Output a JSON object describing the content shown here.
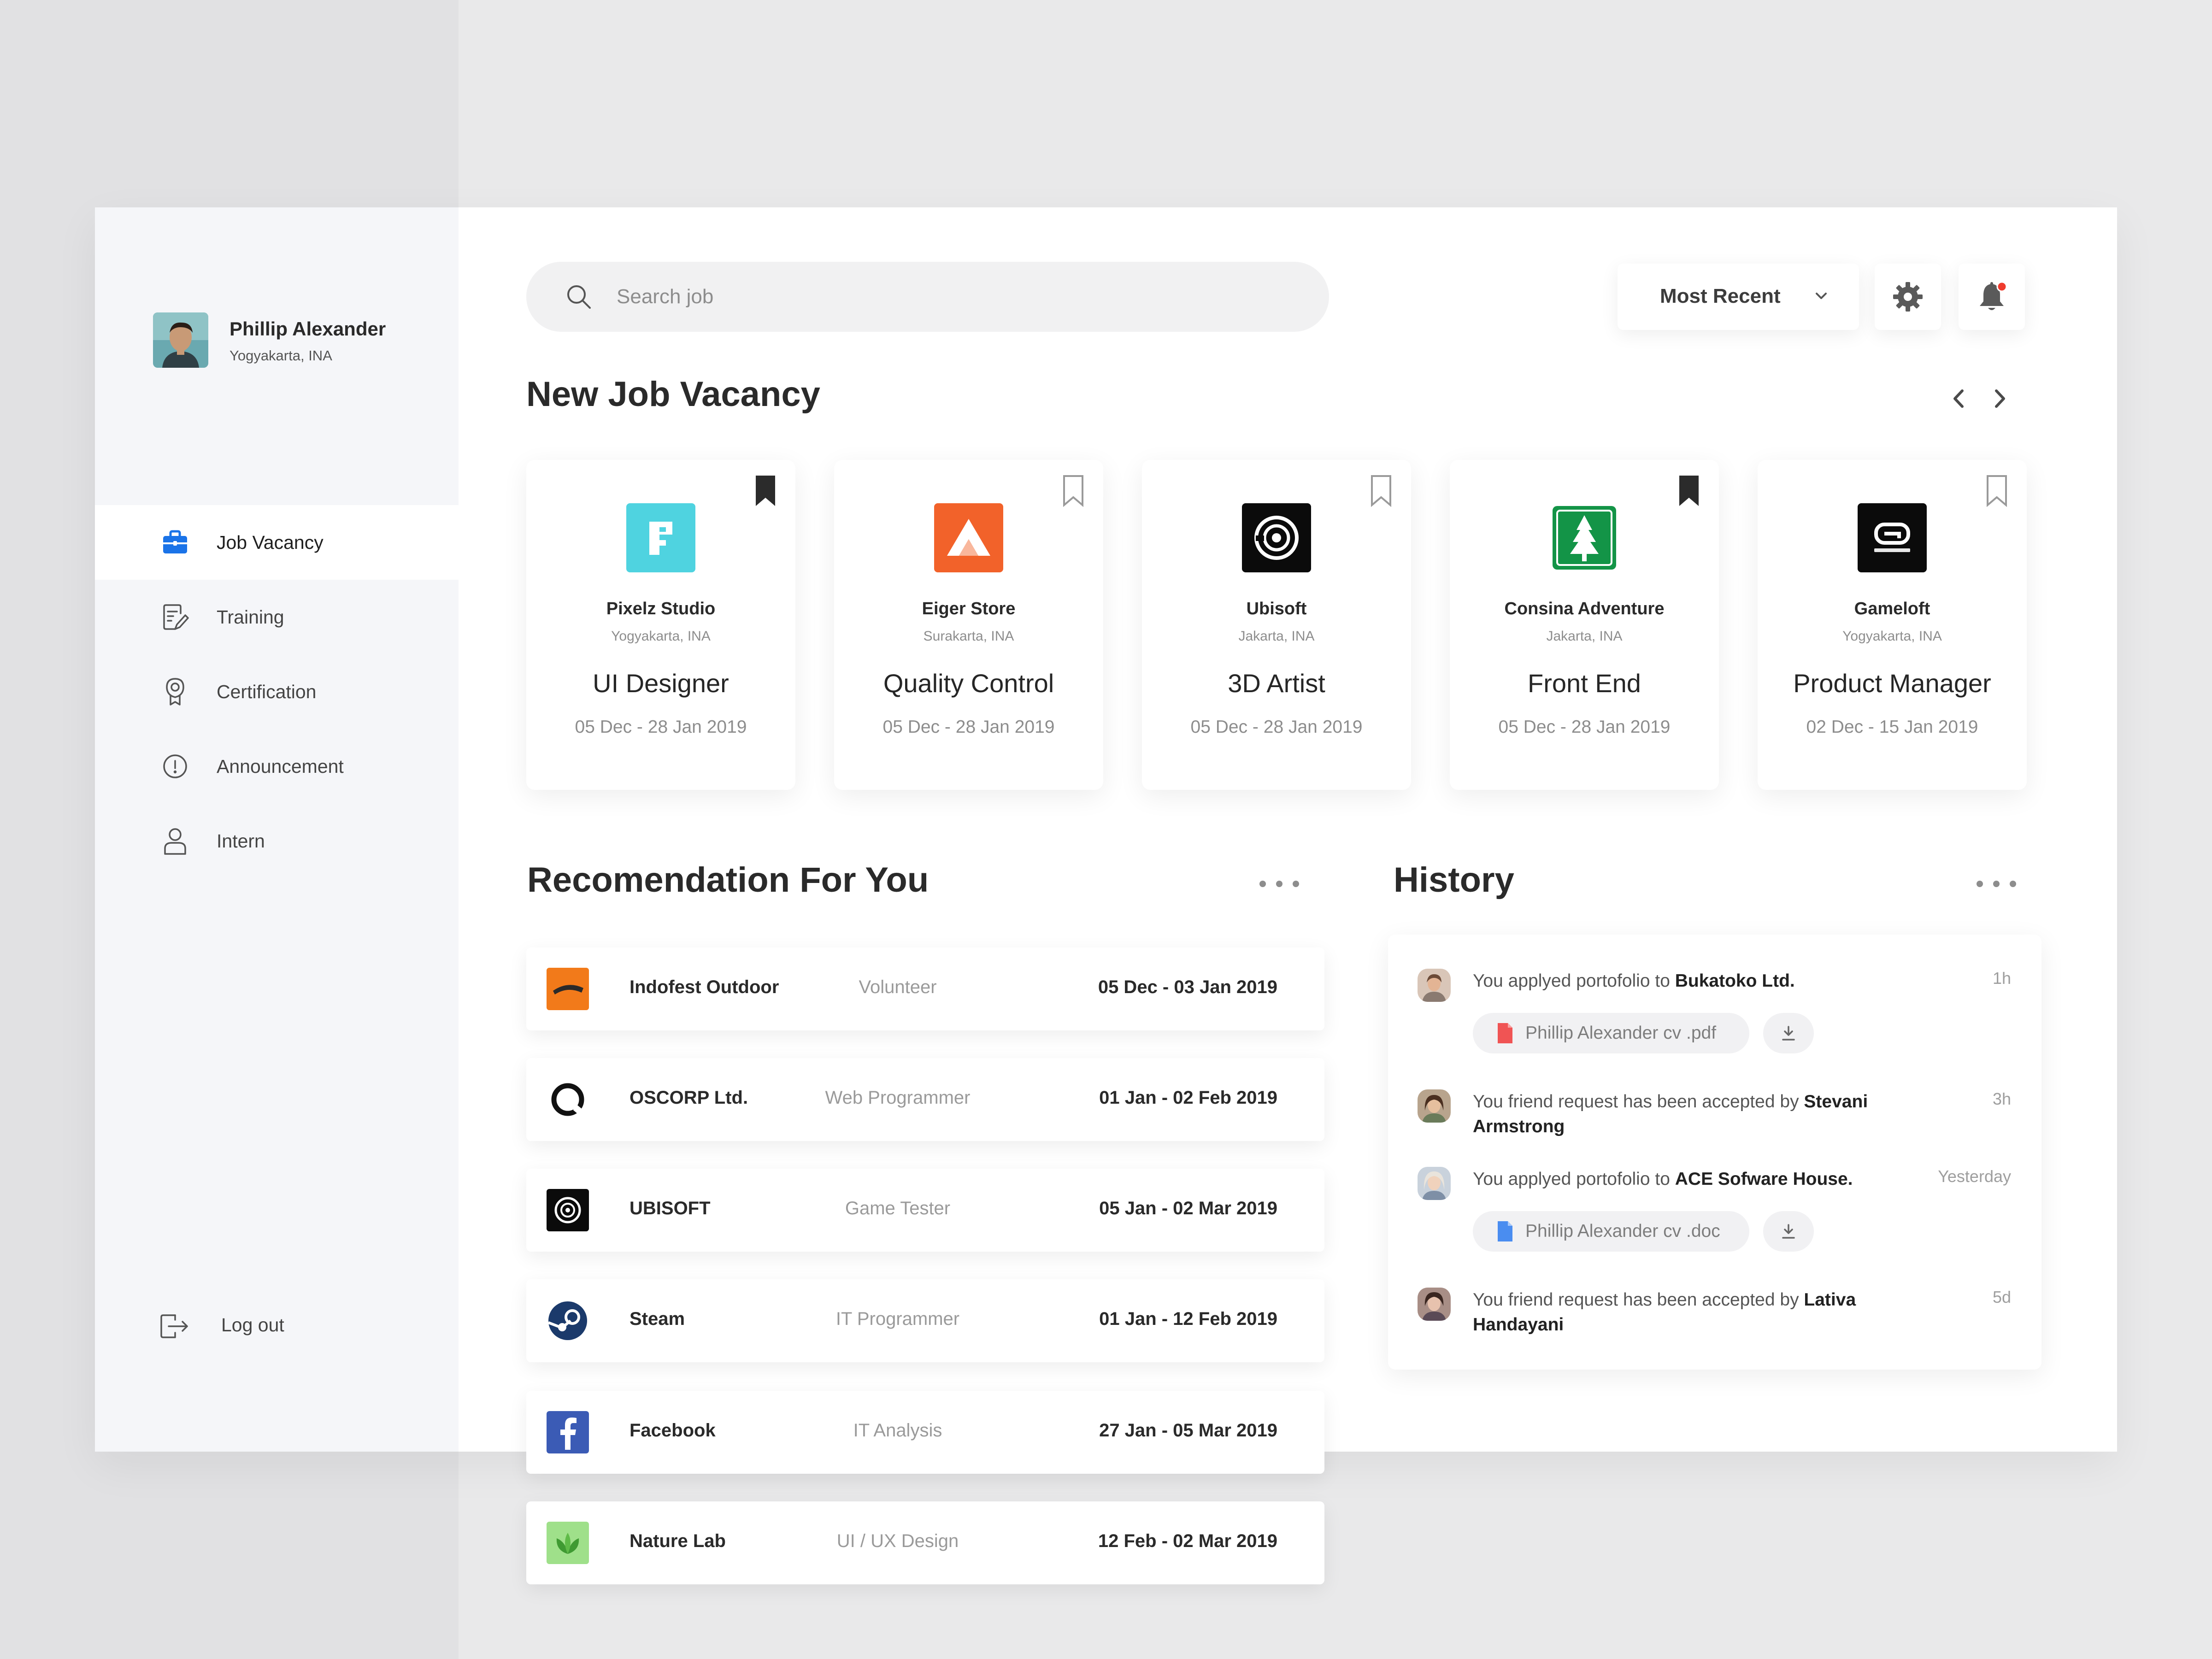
{
  "user": {
    "name": "Phillip Alexander",
    "location": "Yogyakarta, INA"
  },
  "nav": [
    {
      "label": "Job Vacancy",
      "icon": "briefcase-icon",
      "active": true
    },
    {
      "label": "Training",
      "icon": "document-edit-icon",
      "active": false
    },
    {
      "label": "Certification",
      "icon": "award-icon",
      "active": false
    },
    {
      "label": "Announcement",
      "icon": "alert-circle-icon",
      "active": false
    },
    {
      "label": "Intern",
      "icon": "user-icon",
      "active": false
    }
  ],
  "logout_label": "Log out",
  "search": {
    "placeholder": "Search job"
  },
  "sort": {
    "selected": "Most Recent"
  },
  "vacancy": {
    "title": "New Job Vacancy",
    "cards": [
      {
        "company": "Pixelz Studio",
        "location": "Yogyakarta, INA",
        "role": "UI Designer",
        "dates": "05 Dec  - 28 Jan 2019",
        "bookmarked": true
      },
      {
        "company": "Eiger Store",
        "location": "Surakarta, INA",
        "role": "Quality Control",
        "dates": "05 Dec  - 28 Jan 2019",
        "bookmarked": false
      },
      {
        "company": "Ubisoft",
        "location": "Jakarta, INA",
        "role": "3D Artist",
        "dates": "05 Dec  - 28 Jan 2019",
        "bookmarked": false
      },
      {
        "company": "Consina Adventure",
        "location": "Jakarta, INA",
        "role": "Front End",
        "dates": "05 Dec  - 28 Jan 2019",
        "bookmarked": true
      },
      {
        "company": "Gameloft",
        "location": "Yogyakarta, INA",
        "role": "Product Manager",
        "dates": "02 Dec  - 15 Jan 2019",
        "bookmarked": false
      }
    ]
  },
  "recommendation": {
    "title": "Recomendation For You",
    "rows": [
      {
        "company": "Indofest Outdoor",
        "role": "Volunteer",
        "dates": "05 Dec  - 03 Jan 2019"
      },
      {
        "company": "OSCORP Ltd.",
        "role": "Web Programmer",
        "dates": "01 Jan  - 02 Feb 2019"
      },
      {
        "company": "UBISOFT",
        "role": "Game Tester",
        "dates": "05 Jan  - 02 Mar 2019"
      },
      {
        "company": "Steam",
        "role": "IT Programmer",
        "dates": "01 Jan  - 12 Feb 2019"
      },
      {
        "company": "Facebook",
        "role": "IT Analysis",
        "dates": "27 Jan  - 05 Mar 2019"
      },
      {
        "company": "Nature Lab",
        "role": "UI / UX Design",
        "dates": "12 Feb  - 02 Mar 2019"
      }
    ]
  },
  "history": {
    "title": "History",
    "items": [
      {
        "text": "You applyed portofolio to ",
        "bold": "Bukatoko Ltd.",
        "time": "1h",
        "file": "Phillip Alexander cv .pdf"
      },
      {
        "text": "You friend request has been accepted by ",
        "bold": "Stevani Armstrong",
        "time": "3h"
      },
      {
        "text": "You applyed portofolio to ",
        "bold": "ACE Sofware House.",
        "time": "Yesterday",
        "file": "Phillip Alexander cv .doc"
      },
      {
        "text": "You friend request has been accepted by ",
        "bold": "Lativa Handayani",
        "time": "5d"
      }
    ]
  },
  "colors": {
    "accent": "#1a73e8",
    "notification": "#ef3b2d",
    "bookmark_filled": "#2b2b2b"
  }
}
